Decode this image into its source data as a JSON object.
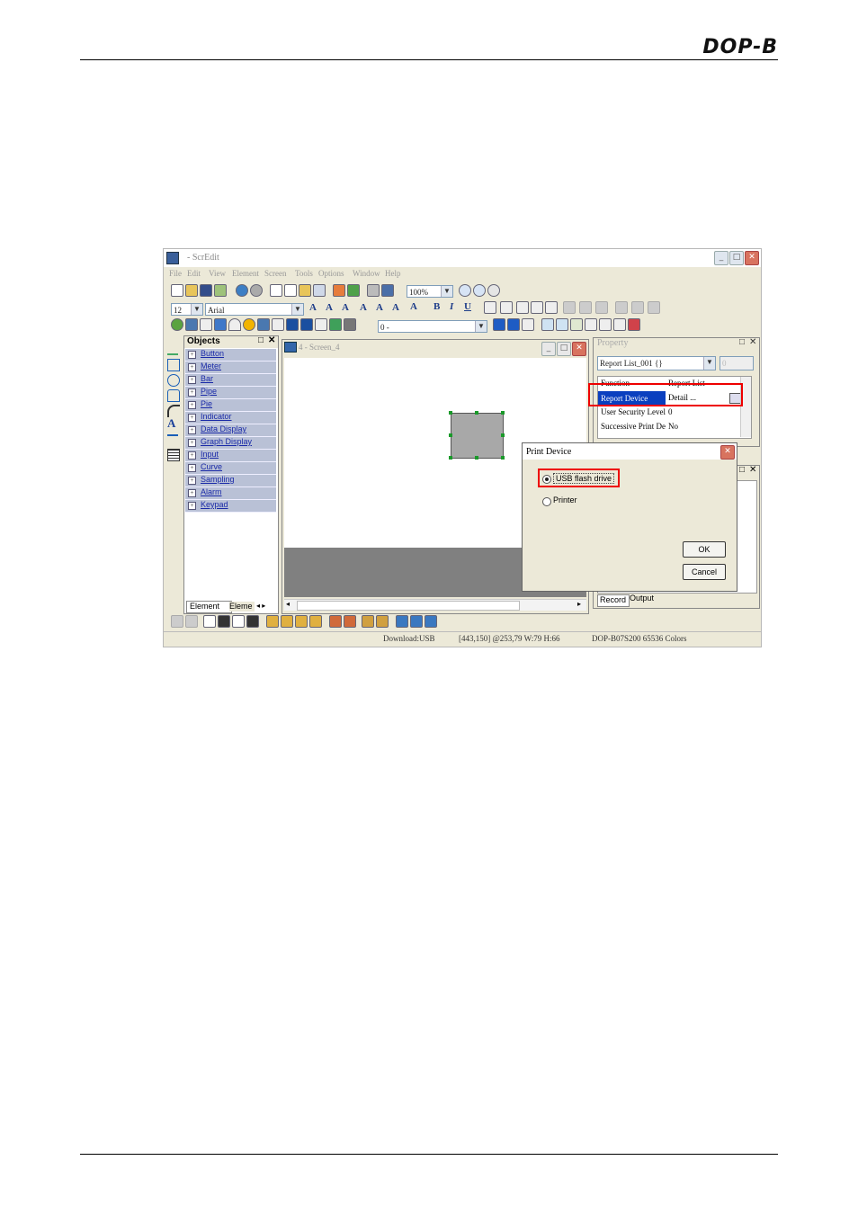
{
  "header": {
    "brand": "DOP-B"
  },
  "window": {
    "title": "- ScrEdit",
    "menu": [
      "File",
      "Edit",
      "View",
      "Element",
      "Screen",
      "Tools",
      "Options",
      "Window",
      "Help"
    ],
    "zoom": "100%",
    "font_size": "12",
    "font_name": "Arial",
    "layer": "0 -"
  },
  "objects_panel": {
    "title": "Objects",
    "items": [
      "Button",
      "Meter",
      "Bar",
      "Pipe",
      "Pie",
      "Indicator",
      "Data Display",
      "Graph Display",
      "Input",
      "Curve",
      "Sampling",
      "Alarm",
      "Keypad"
    ],
    "tabs": [
      "Element",
      "Eleme"
    ]
  },
  "screen_window": {
    "title": "4 - Screen_4"
  },
  "property_panel": {
    "title": "Property",
    "object_select": "Report List_001 {}",
    "page_value": "0",
    "rows": [
      {
        "key": "Function",
        "value": "Report List"
      },
      {
        "key": "Report Device",
        "value": "Detail ..."
      },
      {
        "key": "User Security Level",
        "value": "0"
      },
      {
        "key": "Successive Print De",
        "value": "No"
      }
    ]
  },
  "lower_panel": {
    "tabs": [
      "Record",
      "Output"
    ]
  },
  "dialog": {
    "title": "Print Device",
    "options": [
      "USB flash drive",
      "Printer"
    ],
    "selected": "USB flash drive",
    "ok": "OK",
    "cancel": "Cancel"
  },
  "status": {
    "download": "Download:USB",
    "coords": "[443,150] @253,79 W:79 H:66",
    "model": "DOP-B07S200 65536 Colors"
  },
  "colors": {
    "highlight": "#e00000",
    "selection": "#0a3fbf"
  }
}
